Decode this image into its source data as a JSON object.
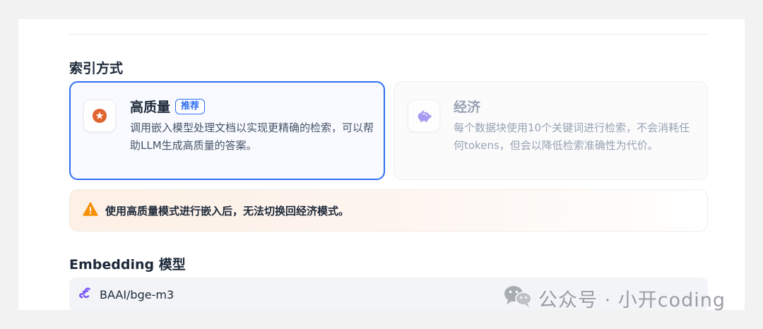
{
  "index_section": {
    "label": "索引方式",
    "high_quality": {
      "title": "高质量",
      "badge": "推荐",
      "description": "调用嵌入模型处理文档以实现更精确的检索，可以帮助LLM生成高质量的答案。",
      "icon": "spark-badge-icon",
      "selected": true
    },
    "economy": {
      "title": "经济",
      "description": "每个数据块使用10个关键词进行检索，不会消耗任何tokens，但会以降低检索准确性为代价。",
      "icon": "piggy-bank-icon",
      "selected": false
    }
  },
  "warning": {
    "text": "使用高质量模式进行嵌入后，无法切换回经济模式。",
    "icon": "warning-triangle-icon"
  },
  "embedding": {
    "label": "Embedding 模型",
    "selected_model": "BAAI/bge-m3",
    "icon": "model-provider-icon"
  },
  "watermark": {
    "text": "公众号 · 小开coding",
    "icon": "wechat-icon"
  },
  "colors": {
    "accent": "#2f6ef2",
    "warning": "#f79009",
    "high_quality_icon": "#e0642e",
    "economy_icon": "#8a7cf0",
    "model_icon": "#7a5af8"
  }
}
